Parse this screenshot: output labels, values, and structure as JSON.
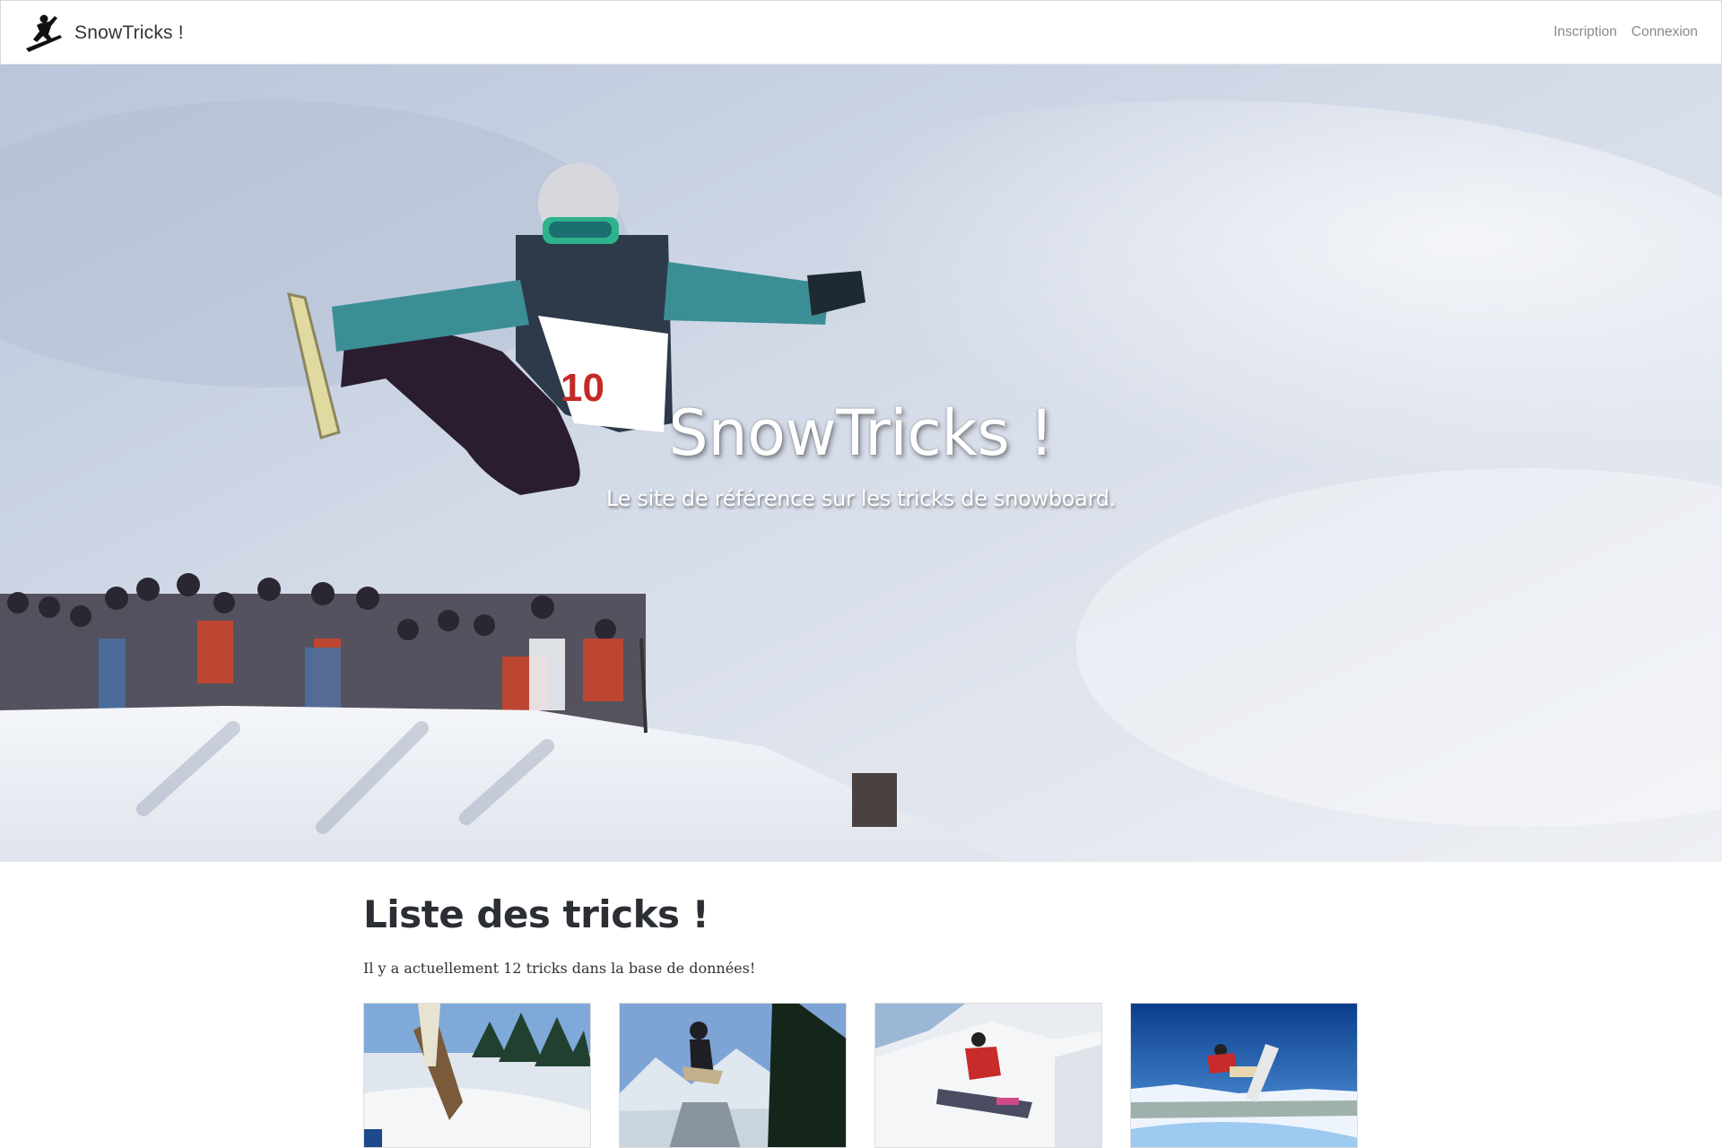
{
  "navbar": {
    "brand": "SnowTricks !",
    "logo_icon": "snowboarder-logo-icon",
    "links": [
      {
        "label": "Inscription"
      },
      {
        "label": "Connexion"
      }
    ]
  },
  "hero": {
    "title": "SnowTricks !",
    "subtitle": "Le site de référence sur les tricks de snowboard."
  },
  "main": {
    "heading": "Liste des tricks !",
    "count_text": "Il y a actuellement 12 tricks dans la base de données!",
    "tricks": [
      {
        "image": "trick-thumbnail-1"
      },
      {
        "image": "trick-thumbnail-2"
      },
      {
        "image": "trick-thumbnail-3"
      },
      {
        "image": "trick-thumbnail-4"
      }
    ]
  },
  "colors": {
    "text_dark": "#2b2f33",
    "nav_link": "#8a8a8a",
    "sky": "#c8d2e2"
  }
}
